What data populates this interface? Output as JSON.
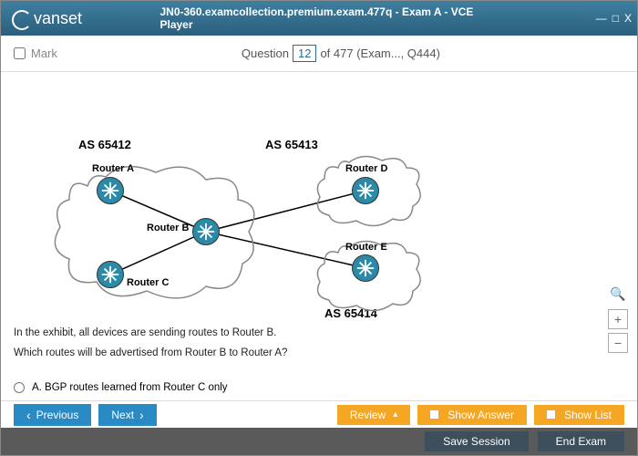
{
  "window": {
    "brand": "vanset",
    "title": "JN0-360.examcollection.premium.exam.477q - Exam A - VCE Player"
  },
  "qbar": {
    "mark": "Mark",
    "question_word": "Question",
    "number": "12",
    "of_text": "of 477 (Exam..., Q444)"
  },
  "diagram": {
    "as1": "AS 65412",
    "as2": "AS 65413",
    "as3": "AS 65414",
    "ra": "Router A",
    "rb": "Router B",
    "rc": "Router C",
    "rd": "Router D",
    "re": "Router E"
  },
  "question": {
    "line1": "In the exhibit, all devices are sending routes to Router B.",
    "line2": "Which routes will be advertised from Router B to Router A?",
    "optA": "A.   BGP routes learned from Router C only"
  },
  "buttons": {
    "previous": "Previous",
    "next": "Next",
    "review": "Review",
    "show_answer": "Show Answer",
    "show_list": "Show List",
    "save_session": "Save Session",
    "end_exam": "End Exam"
  }
}
